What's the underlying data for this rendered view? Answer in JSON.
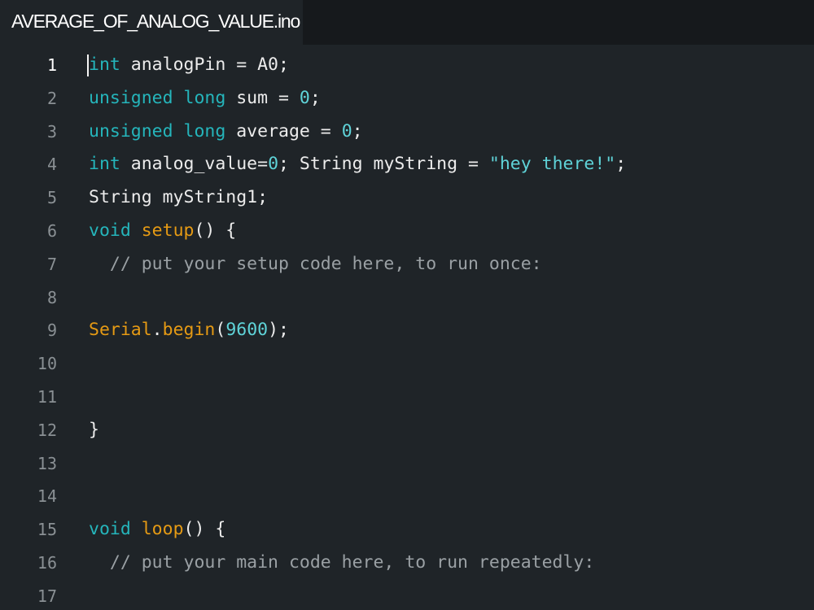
{
  "tab": {
    "filename": "AVERAGE_OF_ANALOG_VALUE.ino"
  },
  "colors": {
    "background": "#1f2428",
    "tabbar": "#16191c",
    "keyword": "#25b5bb",
    "function": "#e59a14",
    "literal": "#5fd3d8",
    "comment": "#9aa0a4",
    "text": "#ececec"
  },
  "editor": {
    "active_line": 1,
    "lines": [
      {
        "num": "1",
        "tokens": [
          {
            "t": "int",
            "c": "kw"
          },
          {
            "t": " analogPin = A0;",
            "c": "pl"
          }
        ]
      },
      {
        "num": "2",
        "tokens": [
          {
            "t": "unsigned",
            "c": "kw"
          },
          {
            "t": " ",
            "c": "pl"
          },
          {
            "t": "long",
            "c": "kw"
          },
          {
            "t": " sum = ",
            "c": "pl"
          },
          {
            "t": "0",
            "c": "num"
          },
          {
            "t": ";",
            "c": "pl"
          }
        ]
      },
      {
        "num": "3",
        "tokens": [
          {
            "t": "unsigned",
            "c": "kw"
          },
          {
            "t": " ",
            "c": "pl"
          },
          {
            "t": "long",
            "c": "kw"
          },
          {
            "t": " average = ",
            "c": "pl"
          },
          {
            "t": "0",
            "c": "num"
          },
          {
            "t": ";",
            "c": "pl"
          }
        ]
      },
      {
        "num": "4",
        "tokens": [
          {
            "t": "int",
            "c": "kw"
          },
          {
            "t": " analog_value=",
            "c": "pl"
          },
          {
            "t": "0",
            "c": "num"
          },
          {
            "t": "; String myString = ",
            "c": "pl"
          },
          {
            "t": "\"hey there!\"",
            "c": "str"
          },
          {
            "t": ";",
            "c": "pl"
          }
        ]
      },
      {
        "num": "5",
        "tokens": [
          {
            "t": "String myString1;",
            "c": "pl"
          }
        ]
      },
      {
        "num": "6",
        "tokens": [
          {
            "t": "void",
            "c": "kw"
          },
          {
            "t": " ",
            "c": "pl"
          },
          {
            "t": "setup",
            "c": "fn"
          },
          {
            "t": "() {",
            "c": "pl"
          }
        ]
      },
      {
        "num": "7",
        "tokens": [
          {
            "t": "  // put your setup code here, to run once:",
            "c": "cm"
          }
        ]
      },
      {
        "num": "8",
        "tokens": []
      },
      {
        "num": "9",
        "tokens": [
          {
            "t": "Serial",
            "c": "fn"
          },
          {
            "t": ".",
            "c": "pl"
          },
          {
            "t": "begin",
            "c": "fn"
          },
          {
            "t": "(",
            "c": "pl"
          },
          {
            "t": "9600",
            "c": "num"
          },
          {
            "t": ");",
            "c": "pl"
          }
        ]
      },
      {
        "num": "10",
        "tokens": []
      },
      {
        "num": "11",
        "tokens": []
      },
      {
        "num": "12",
        "tokens": [
          {
            "t": "}",
            "c": "pl"
          }
        ]
      },
      {
        "num": "13",
        "tokens": []
      },
      {
        "num": "14",
        "tokens": []
      },
      {
        "num": "15",
        "tokens": [
          {
            "t": "void",
            "c": "kw"
          },
          {
            "t": " ",
            "c": "pl"
          },
          {
            "t": "loop",
            "c": "fn"
          },
          {
            "t": "() {",
            "c": "pl"
          }
        ]
      },
      {
        "num": "16",
        "tokens": [
          {
            "t": "  // put your main code here, to run repeatedly:",
            "c": "cm"
          }
        ]
      },
      {
        "num": "17",
        "tokens": []
      }
    ]
  }
}
